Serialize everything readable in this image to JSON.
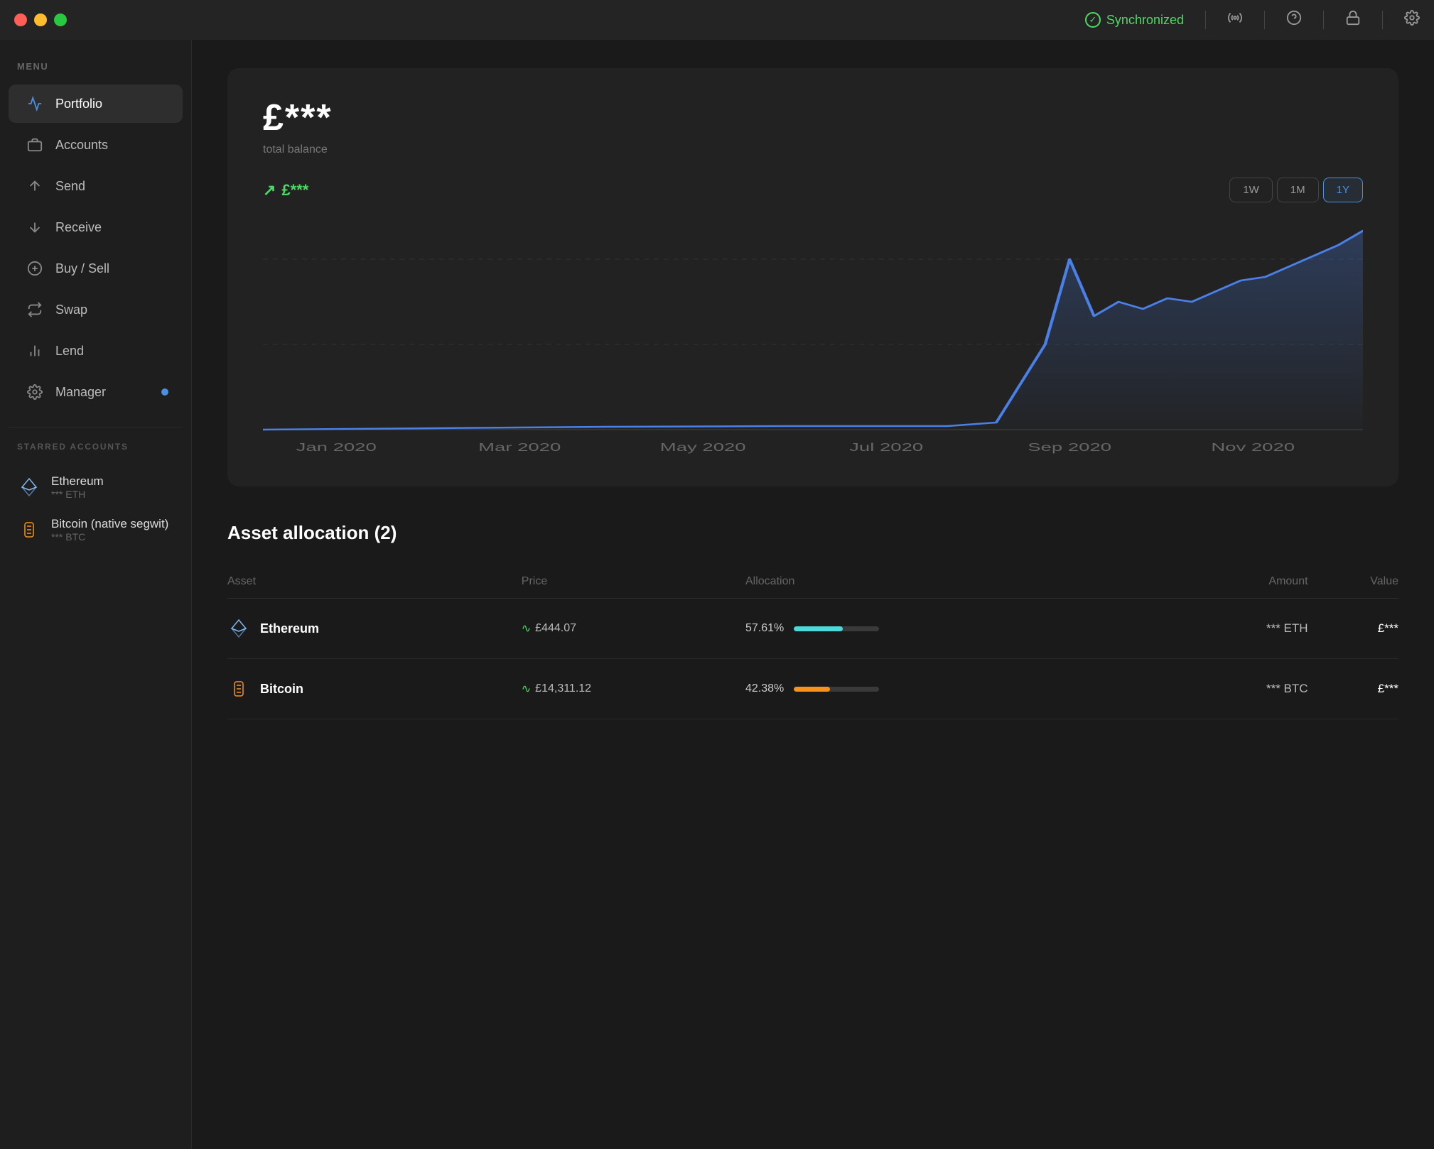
{
  "titleBar": {
    "syncStatus": "Synchronized",
    "icons": [
      "broadcast-icon",
      "help-icon",
      "lock-icon",
      "settings-icon"
    ]
  },
  "sidebar": {
    "menuLabel": "MENU",
    "navItems": [
      {
        "id": "portfolio",
        "label": "Portfolio",
        "icon": "chart-icon",
        "active": true
      },
      {
        "id": "accounts",
        "label": "Accounts",
        "icon": "wallet-icon",
        "active": false
      },
      {
        "id": "send",
        "label": "Send",
        "icon": "send-icon",
        "active": false
      },
      {
        "id": "receive",
        "label": "Receive",
        "icon": "receive-icon",
        "active": false
      },
      {
        "id": "buysell",
        "label": "Buy / Sell",
        "icon": "dollar-icon",
        "active": false
      },
      {
        "id": "swap",
        "label": "Swap",
        "icon": "swap-icon",
        "active": false
      },
      {
        "id": "lend",
        "label": "Lend",
        "icon": "lend-icon",
        "active": false
      },
      {
        "id": "manager",
        "label": "Manager",
        "icon": "manager-icon",
        "active": false,
        "badge": true
      }
    ],
    "starredAccountsLabel": "STARRED ACCOUNTS",
    "starredAccounts": [
      {
        "id": "eth",
        "name": "Ethereum",
        "amount": "*** ETH",
        "icon": "eth-icon"
      },
      {
        "id": "btc",
        "name": "Bitcoin (native segwit)",
        "amount": "*** BTC",
        "icon": "btc-icon"
      }
    ]
  },
  "portfolio": {
    "balance": "£***",
    "balanceLabel": "total balance",
    "change": "£***",
    "changePositive": true,
    "periodButtons": [
      "1W",
      "1M",
      "1Y"
    ],
    "activePeriod": "1Y",
    "chartLabels": [
      "Jan 2020",
      "Mar 2020",
      "May 2020",
      "Jul 2020",
      "Sep 2020",
      "Nov 2020"
    ]
  },
  "assetAllocation": {
    "title": "Asset allocation (2)",
    "columns": [
      "Asset",
      "Price",
      "Allocation",
      "Amount",
      "Value"
    ],
    "rows": [
      {
        "id": "eth",
        "asset": "Ethereum",
        "price": "£444.07",
        "allocPct": "57.61%",
        "allocBarWidth": 57.61,
        "allocBarColor": "eth",
        "amount": "*** ETH",
        "value": "£***"
      },
      {
        "id": "btc",
        "asset": "Bitcoin",
        "price": "£14,311.12",
        "allocPct": "42.38%",
        "allocBarWidth": 42.38,
        "allocBarColor": "btc",
        "amount": "*** BTC",
        "value": "£***"
      }
    ]
  }
}
